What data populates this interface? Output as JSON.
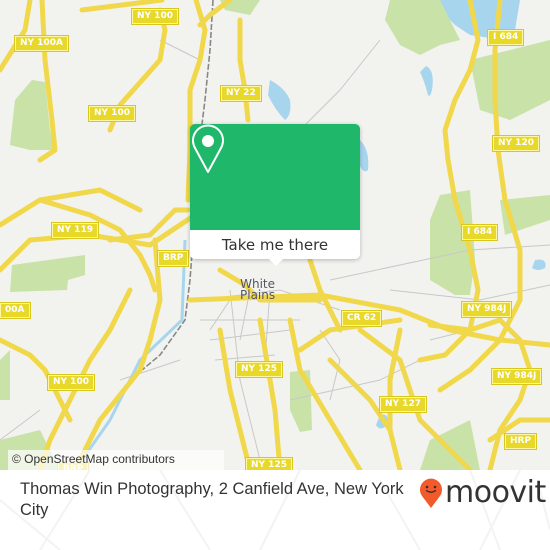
{
  "map": {
    "city_label_line1": "White",
    "city_label_line2": "Plains",
    "road_shields": [
      {
        "id": "ny100-top",
        "label": "NY 100"
      },
      {
        "id": "ny100a-top",
        "label": "NY 100A"
      },
      {
        "id": "ny100-mid",
        "label": "NY 100"
      },
      {
        "id": "ny22",
        "label": "NY 22"
      },
      {
        "id": "i684-top",
        "label": "I 684"
      },
      {
        "id": "ny120",
        "label": "NY 120"
      },
      {
        "id": "ny119",
        "label": "NY 119"
      },
      {
        "id": "brp-left",
        "label": "BRP"
      },
      {
        "id": "i684-mid",
        "label": "I 684"
      },
      {
        "id": "ny100a-left",
        "label": "00A"
      },
      {
        "id": "cr62",
        "label": "CR 62"
      },
      {
        "id": "ny984j-mid",
        "label": "NY 984J"
      },
      {
        "id": "ny125-mid",
        "label": "NY 125"
      },
      {
        "id": "ny984j-right",
        "label": "NY 984J"
      },
      {
        "id": "ny100-low",
        "label": "NY 100"
      },
      {
        "id": "ny127",
        "label": "NY 127"
      },
      {
        "id": "ny125-low",
        "label": "NY 125"
      },
      {
        "id": "hrp",
        "label": "HRP"
      },
      {
        "id": "brp-bottom",
        "label": "BRP"
      }
    ],
    "colors": {
      "land": "#f2f2ef",
      "road": "#f7e36c",
      "park": "#c9e2a8",
      "water": "#a8d5ee"
    }
  },
  "popup": {
    "icon": "map-pin-icon",
    "button_label": "Take me there",
    "color": "#1fb86b"
  },
  "attribution": "© OpenStreetMap contributors",
  "footer": {
    "address": "Thomas Win Photography, 2 Canfield Ave, New York City",
    "brand_name": "moovit",
    "brand_icon": "moovit-logo-icon",
    "brand_color": "#f25a2c"
  }
}
